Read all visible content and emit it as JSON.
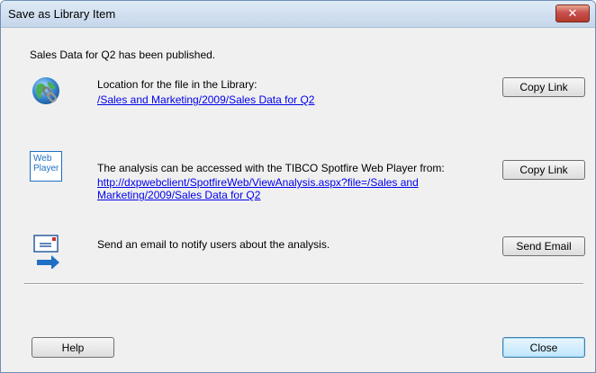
{
  "window": {
    "title": "Save as Library Item"
  },
  "message": {
    "published": "Sales Data for Q2 has been published."
  },
  "library": {
    "label": "Location for the file in the Library:",
    "link": "/Sales and Marketing/2009/Sales Data for Q2",
    "copy_button": "Copy Link",
    "icon": "globe-link-icon"
  },
  "webplayer": {
    "icon_text_line1": "Web",
    "icon_text_line2": "Player",
    "label": "The analysis can be accessed with the TIBCO Spotfire Web Player from:",
    "link_line1": "http://dxpwebclient/SpotfireWeb/ViewAnalysis.aspx?file=/Sales and",
    "link_line2": "Marketing/2009/Sales Data for Q2",
    "copy_button": "Copy Link"
  },
  "email": {
    "label": "Send an email to notify users about the analysis.",
    "button": "Send Email",
    "icon": "send-email-icon"
  },
  "footer": {
    "help_button": "Help",
    "close_button": "Close"
  },
  "colors": {
    "link": "#0000ee",
    "accent": "#1f6fc5",
    "titlebar": "#c5d6ea"
  }
}
